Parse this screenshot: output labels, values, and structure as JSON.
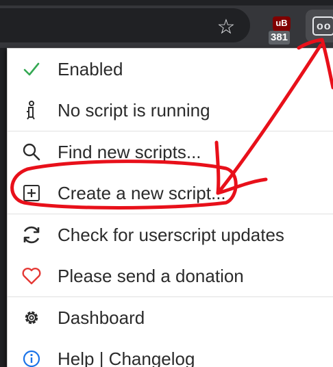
{
  "toolbar": {
    "star_icon": "star-icon",
    "ublock": {
      "shield_text": "uB",
      "badge_count": "381"
    },
    "tampermonkey_icon_text": "oo"
  },
  "menu": {
    "items": [
      {
        "icon": "check-icon",
        "label": "Enabled"
      },
      {
        "icon": "script-running-icon",
        "label": "No script is running"
      },
      {
        "icon": "search-icon",
        "label": "Find new scripts..."
      },
      {
        "icon": "plus-square-icon",
        "label": "Create a new script..."
      },
      {
        "icon": "refresh-icon",
        "label": "Check for userscript updates"
      },
      {
        "icon": "heart-icon",
        "label": "Please send a donation"
      },
      {
        "icon": "gear-icon",
        "label": "Dashboard"
      },
      {
        "icon": "info-icon",
        "label": "Help | Changelog"
      }
    ]
  },
  "colors": {
    "check": "#34a853",
    "heart": "#e53935",
    "info": "#1a73e8",
    "annotation": "#e8101a"
  }
}
